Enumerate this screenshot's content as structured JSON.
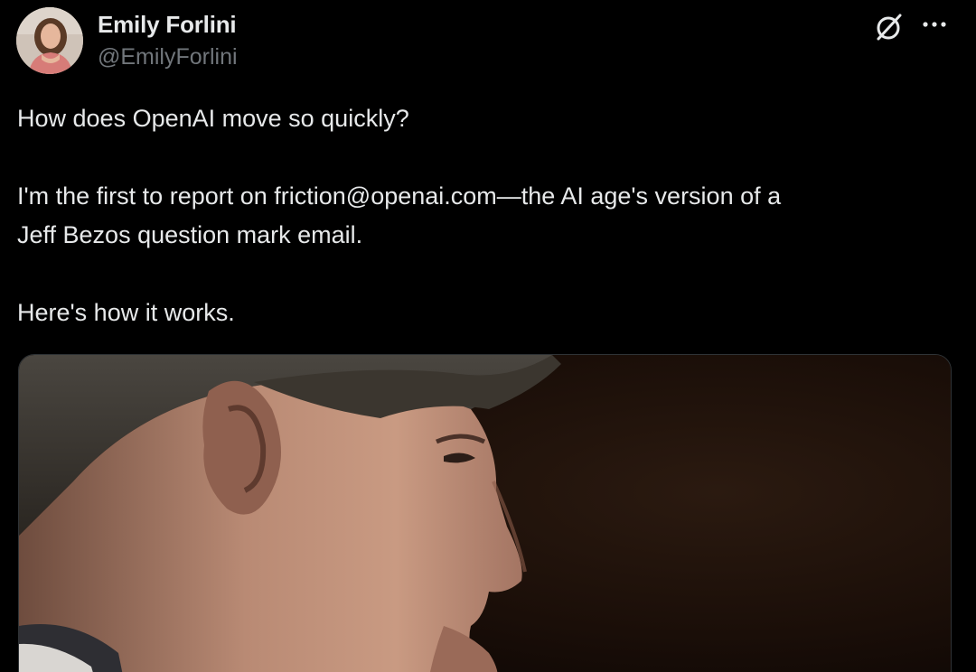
{
  "author": {
    "display_name": "Emily Forlini",
    "handle": "@EmilyForlini",
    "avatar_icon": "person-avatar"
  },
  "header_icons": {
    "grok": "grok-icon",
    "more": "more-options-icon"
  },
  "tweet": {
    "paragraphs": [
      "How does OpenAI move so quickly?",
      "I'm the first to report on friction@openai.com—the AI age's version of a",
      "Jeff Bezos question mark email.",
      "Here's how it works."
    ]
  },
  "media": {
    "type": "photo",
    "subject": "man-profile-portrait"
  },
  "colors": {
    "background": "#000000",
    "primary_text": "#e7e9ea",
    "secondary_text": "#71767b",
    "border": "#2f3336"
  }
}
